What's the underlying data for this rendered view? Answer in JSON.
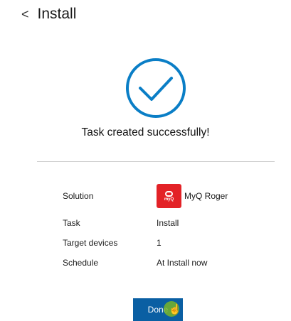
{
  "header": {
    "back_icon": "<",
    "title": "Install"
  },
  "status": {
    "message": "Task created successfully!",
    "icon": "check-circle-icon",
    "accent": "#0a7ec6"
  },
  "details": {
    "rows": [
      {
        "label": "Solution",
        "value": "MyQ Roger",
        "logo_text": "myQ"
      },
      {
        "label": "Task",
        "value": "Install"
      },
      {
        "label": "Target devices",
        "value": "1"
      },
      {
        "label": "Schedule",
        "value": "At Install now"
      }
    ]
  },
  "actions": {
    "done_label": "Done",
    "button_color": "#0a5fa3"
  }
}
